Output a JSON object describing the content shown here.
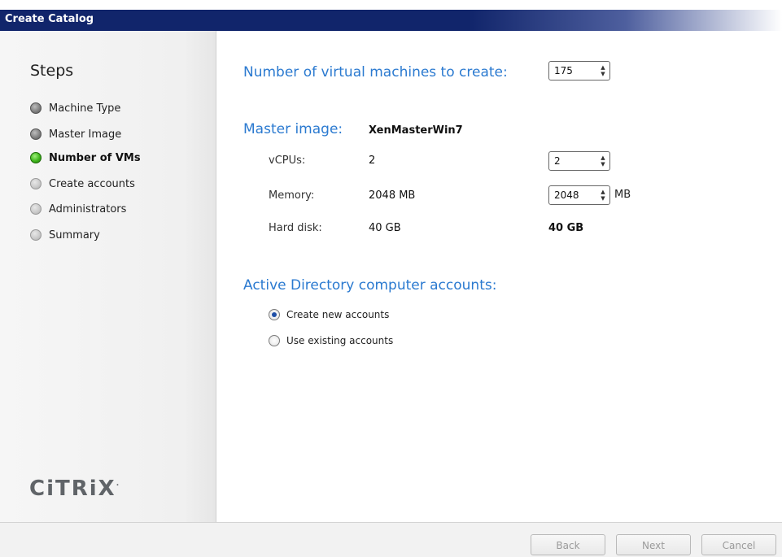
{
  "window": {
    "title": "Create Catalog"
  },
  "sidebar": {
    "title": "Steps",
    "steps": [
      {
        "label": "Machine Type",
        "state": "done"
      },
      {
        "label": "Master Image",
        "state": "done"
      },
      {
        "label": "Number of VMs",
        "state": "current"
      },
      {
        "label": "Create accounts",
        "state": "pending"
      },
      {
        "label": "Administrators",
        "state": "pending"
      },
      {
        "label": "Summary",
        "state": "pending"
      }
    ],
    "logo": "CiTRiX"
  },
  "main": {
    "vm_count_label": "Number of virtual machines to create:",
    "vm_count_value": "175",
    "master_image_label": "Master image:",
    "master_image_value": "XenMasterWin7",
    "vcpus": {
      "label": "vCPUs:",
      "value": "2",
      "input": "2"
    },
    "memory": {
      "label": "Memory:",
      "value": "2048 MB",
      "input": "2048",
      "unit": "MB"
    },
    "hard_disk": {
      "label": "Hard disk:",
      "value": "40 GB",
      "value_right": "40 GB"
    },
    "ad_heading": "Active Directory computer accounts:",
    "ad_options": [
      {
        "label": "Create new accounts",
        "selected": true
      },
      {
        "label": "Use existing accounts",
        "selected": false
      }
    ]
  },
  "footer": {
    "back": "Back",
    "next": "Next",
    "cancel": "Cancel"
  },
  "colors": {
    "title_bar": "#11256b",
    "heading": "#2b7ad0",
    "current_step": "#3fb51c"
  }
}
